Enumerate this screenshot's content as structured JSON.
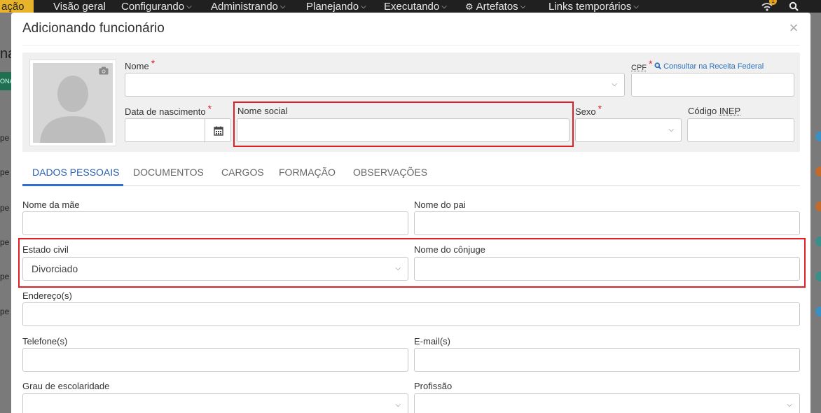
{
  "topnav": {
    "brand": "ação",
    "items": [
      "Visão geral",
      "Configurando",
      "Administrando",
      "Planejando",
      "Executando",
      "Artefatos",
      "Links temporários"
    ],
    "notification_count": "1",
    "icons": [
      "wifi-icon",
      "search-icon",
      "gear-icon"
    ]
  },
  "background": {
    "left_texts": [
      "na",
      "pe",
      "pe",
      "pe",
      "pe",
      "pe",
      "pe"
    ],
    "green_label": "ONA"
  },
  "modal": {
    "title": "Adicionando funcionário",
    "close": "×",
    "header": {
      "nome_label": "Nome",
      "cpf_label": "CPF",
      "consultar_link": "Consultar na Receita Federal",
      "data_nascimento_label": "Data de nascimento",
      "nome_social_label": "Nome social",
      "sexo_label": "Sexo",
      "codigo_inep_prefix": "Código ",
      "codigo_inep_abbr": "INEP",
      "required_mark": "*"
    },
    "tabs": [
      "DADOS PESSOAIS",
      "DOCUMENTOS",
      "CARGOS",
      "FORMAÇÃO",
      "OBSERVAÇÕES"
    ],
    "active_tab": "DADOS PESSOAIS",
    "form": {
      "nome_mae_label": "Nome da mãe",
      "nome_pai_label": "Nome do pai",
      "estado_civil_label": "Estado civil",
      "estado_civil_value": "Divorciado",
      "nome_conjuge_label": "Nome do cônjuge",
      "endereco_label": "Endereço(s)",
      "telefone_label": "Telefone(s)",
      "email_label": "E-mail(s)",
      "escolaridade_label": "Grau de escolaridade",
      "profissao_label": "Profissão"
    }
  },
  "colors": {
    "brand_yellow": "#e6b32a",
    "nav_bg": "#202020",
    "active_tab_blue": "#2f6fd0",
    "required_red": "#d9222a",
    "highlight_red": "#e01f26",
    "link_blue": "#2a6ebb"
  }
}
